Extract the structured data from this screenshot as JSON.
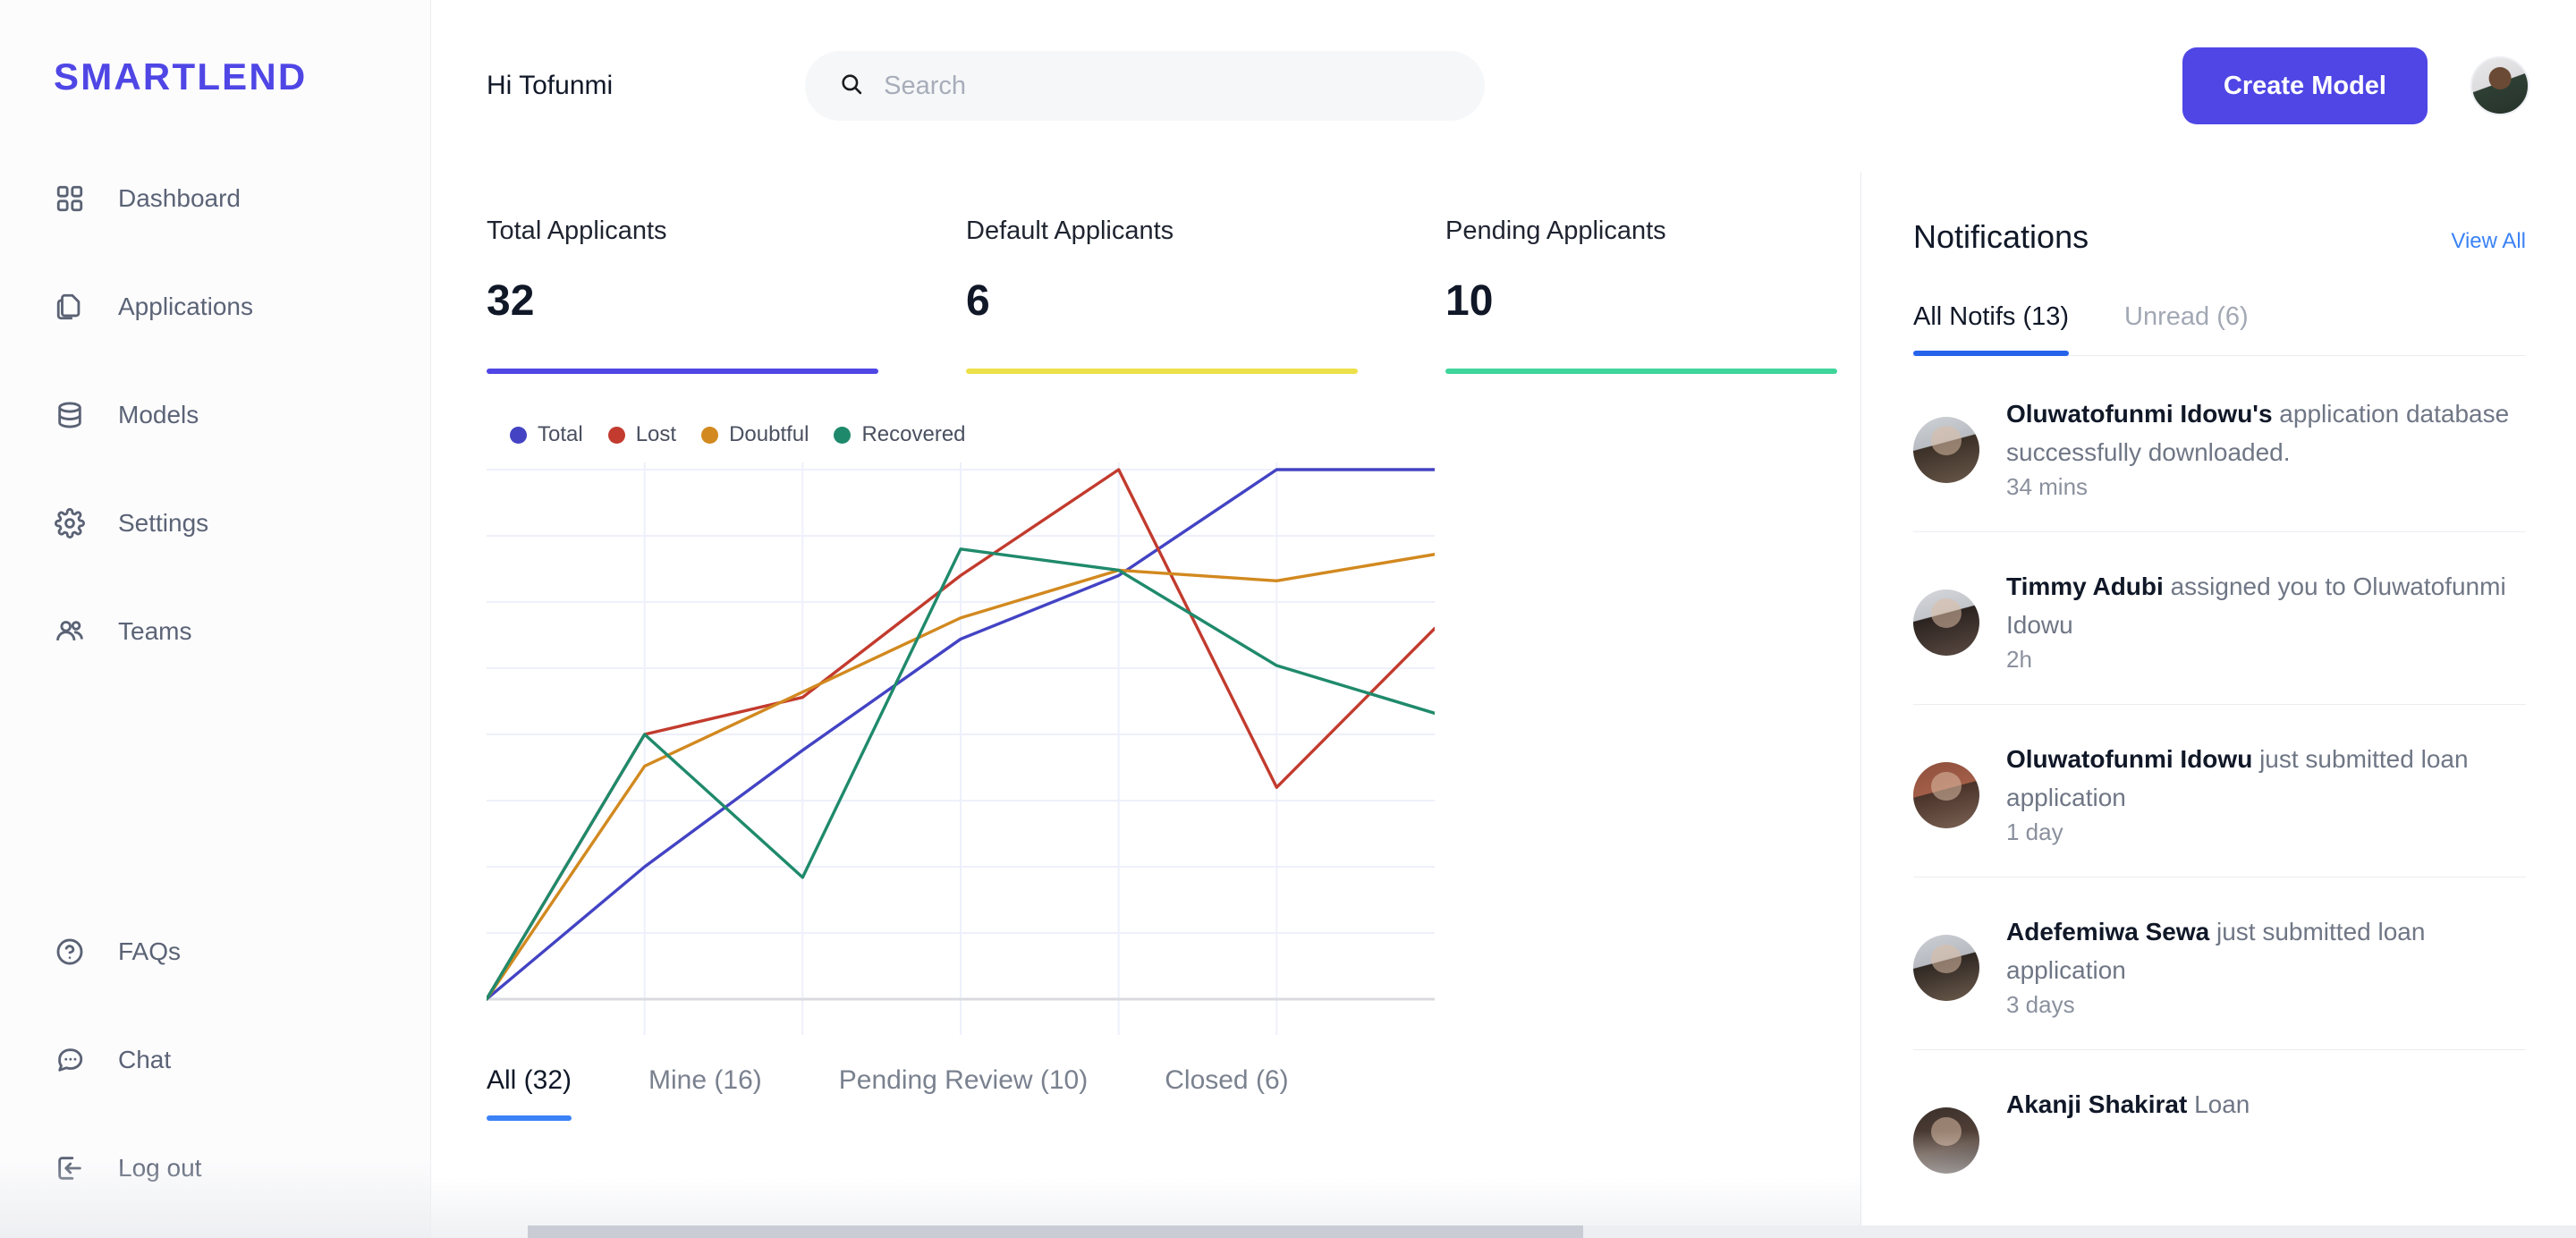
{
  "brand": {
    "name": "SMARTLEND",
    "accent": "#4f46e5"
  },
  "sidebar": {
    "top_items": [
      {
        "label": "Dashboard",
        "icon": "grid-icon"
      },
      {
        "label": "Applications",
        "icon": "documents-icon"
      },
      {
        "label": "Models",
        "icon": "database-icon"
      },
      {
        "label": "Settings",
        "icon": "gear-icon"
      },
      {
        "label": "Teams",
        "icon": "users-icon"
      }
    ],
    "bottom_items": [
      {
        "label": "FAQs",
        "icon": "help-circle-icon"
      },
      {
        "label": "Chat",
        "icon": "chat-bubble-icon"
      },
      {
        "label": "Log out",
        "icon": "logout-icon"
      }
    ]
  },
  "topbar": {
    "greeting": "Hi Tofunmi",
    "search_placeholder": "Search",
    "search_value": "",
    "create_button": "Create Model"
  },
  "stats": [
    {
      "label": "Total Applicants",
      "value": "32",
      "color": "#4f46e5"
    },
    {
      "label": "Default Applicants",
      "value": "6",
      "color": "#ede14a"
    },
    {
      "label": "Pending Applicants",
      "value": "10",
      "color": "#3ed69b"
    }
  ],
  "chart_data": {
    "type": "line",
    "title": "",
    "xlabel": "",
    "ylabel": "",
    "grid": true,
    "legend_position": "top-left",
    "x": [
      0,
      1,
      2,
      3,
      4,
      5,
      6
    ],
    "xlim": [
      0,
      6
    ],
    "ylim": [
      0,
      100
    ],
    "series": [
      {
        "name": "Total",
        "color": "#4343c4",
        "values": [
          0,
          25,
          47,
          68,
          80,
          100,
          100
        ]
      },
      {
        "name": "Lost",
        "color": "#c23b2e",
        "values": [
          0,
          50,
          57,
          80,
          100,
          40,
          70
        ]
      },
      {
        "name": "Doubtful",
        "color": "#d2891f",
        "values": [
          0,
          44,
          58,
          72,
          81,
          79,
          84
        ]
      },
      {
        "name": "Recovered",
        "color": "#1f8a6b",
        "values": [
          0,
          50,
          23,
          85,
          81,
          63,
          54
        ]
      }
    ]
  },
  "filter_tabs": [
    {
      "label": "All (32)",
      "active": true
    },
    {
      "label": "Mine (16)",
      "active": false
    },
    {
      "label": "Pending Review (10)",
      "active": false
    },
    {
      "label": "Closed (6)",
      "active": false
    }
  ],
  "notifications": {
    "title": "Notifications",
    "view_all": "View All",
    "tabs": [
      {
        "label": "All Notifs (13)",
        "active": true
      },
      {
        "label": "Unread (6)",
        "active": false
      }
    ],
    "items": [
      {
        "actor": "Oluwatofunmi Idowu's",
        "rest": " application database successfully downloaded.",
        "time": "34 mins",
        "face": "face-a"
      },
      {
        "actor": "Timmy Adubi",
        "rest": " assigned you to Oluwatofunmi Idowu",
        "time": "2h",
        "face": "face-b"
      },
      {
        "actor": "Oluwatofunmi Idowu",
        "rest": " just submitted loan application",
        "time": "1 day",
        "face": "face-c"
      },
      {
        "actor": "Adefemiwa Sewa",
        "rest": " just submitted loan application",
        "time": "3 days",
        "face": "face-d"
      },
      {
        "actor": "Akanji Shakirat",
        "rest": " Loan",
        "time": "",
        "face": "face-e"
      }
    ]
  }
}
